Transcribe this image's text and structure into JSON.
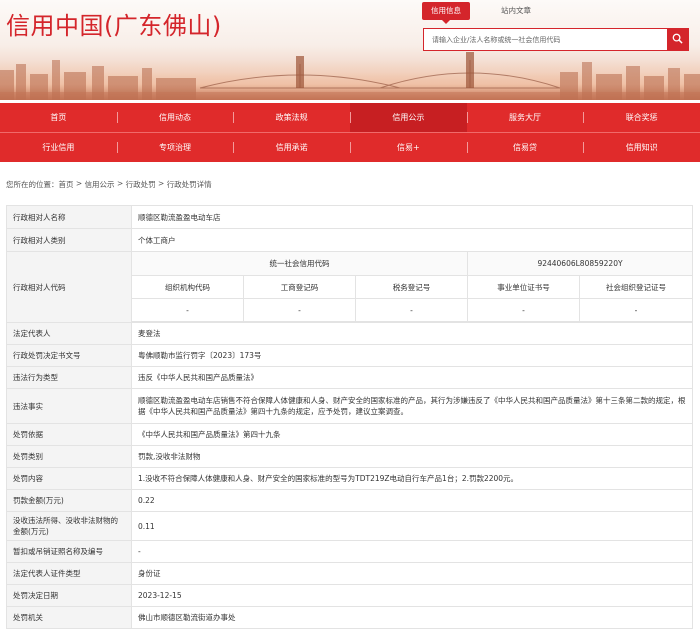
{
  "header": {
    "logo_text": "信用中国(广东佛山)",
    "top_tabs": [
      {
        "label": "信用信息",
        "active": true
      },
      {
        "label": "站内文章",
        "active": false
      }
    ],
    "search": {
      "placeholder": "请输入企业/法人名称或统一社会信用代码"
    },
    "icons": {
      "search": "search-icon"
    },
    "accent_color": "#d4252b"
  },
  "nav": {
    "row1": [
      "首页",
      "信用动态",
      "政策法规",
      "信用公示",
      "服务大厅",
      "联合奖惩"
    ],
    "row2": [
      "行业信用",
      "专项治理",
      "信用承诺",
      "信易+",
      "信易贷",
      "信用知识"
    ],
    "active": "信用公示"
  },
  "breadcrumb": {
    "prefix": "您所在的位置：",
    "items": [
      "首页",
      "信用公示",
      "行政处罚",
      "行政处罚详情"
    ],
    "separator": " > "
  },
  "detail": {
    "party_name": {
      "label": "行政相对人名称",
      "value": "顺德区勒流盈盈电动车店"
    },
    "party_type": {
      "label": "行政相对人类别",
      "value": "个体工商户"
    },
    "party_code": {
      "label": "行政相对人代码",
      "uscc_label": "统一社会信用代码",
      "uscc_value": "92440606L80859220Y",
      "sub_headers": [
        "组织机构代码",
        "工商登记码",
        "税务登记号",
        "事业单位证书号",
        "社会组织登记证号"
      ],
      "sub_values": [
        "-",
        "-",
        "-",
        "-",
        "-"
      ]
    },
    "rows": [
      {
        "label": "法定代表人",
        "value": "麦登法"
      },
      {
        "label": "行政处罚决定书文号",
        "value": "粤佛顺勒市监行罚字〔2023〕173号"
      },
      {
        "label": "违法行为类型",
        "value": "违反《中华人民共和国产品质量法》"
      },
      {
        "label": "违法事实",
        "value": "顺德区勒流盈盈电动车店销售不符合保障人体健康和人身、财产安全的国家标准的产品，其行为涉嫌违反了《中华人民共和国产品质量法》第十三条第二款的规定，根据《中华人民共和国产品质量法》第四十九条的规定，应予处罚，建议立案调查。"
      },
      {
        "label": "处罚依据",
        "value": "《中华人民共和国产品质量法》第四十九条"
      },
      {
        "label": "处罚类别",
        "value": "罚款,没收非法财物"
      },
      {
        "label": "处罚内容",
        "value": "1.没收不符合保障人体健康和人身、财产安全的国家标准的型号为TDT219Z电动自行车产品1台；2.罚款2200元。"
      },
      {
        "label": "罚款金额(万元)",
        "value": "0.22"
      },
      {
        "label": "没收违法所得、没收非法财物的金额(万元)",
        "value": "0.11"
      },
      {
        "label": "暂扣或吊销证照名称及编号",
        "value": "-"
      },
      {
        "label": "法定代表人证件类型",
        "value": "身份证"
      },
      {
        "label": "处罚决定日期",
        "value": "2023-12-15"
      },
      {
        "label": "处罚机关",
        "value": "佛山市顺德区勒流街道办事处"
      }
    ]
  }
}
